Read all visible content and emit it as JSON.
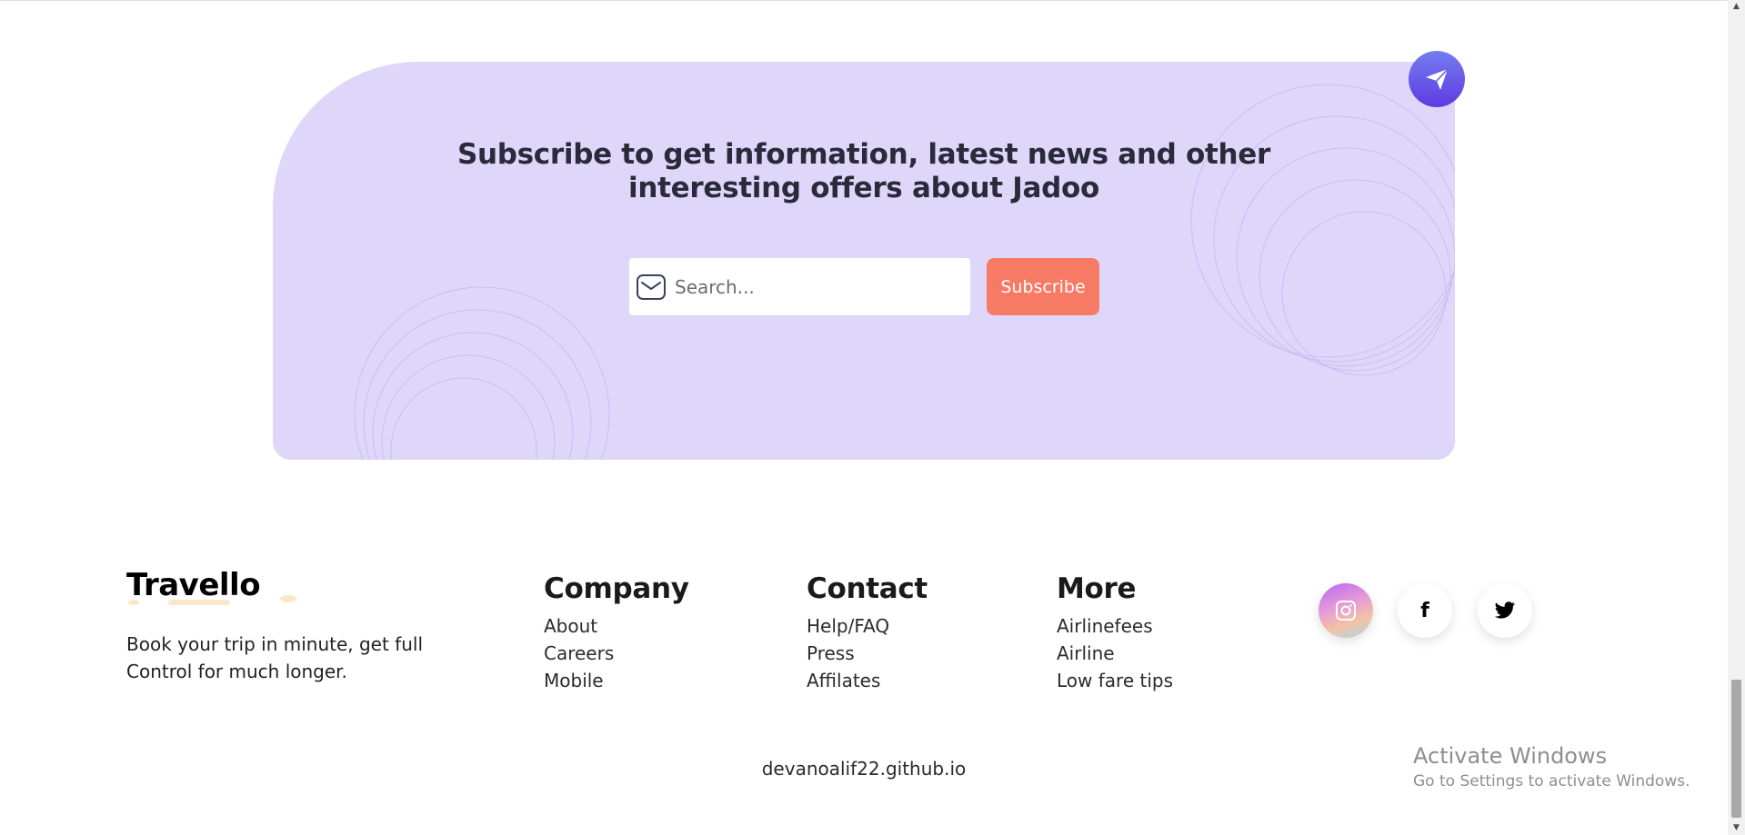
{
  "subscribe": {
    "title_line1": "Subscribe to get information, latest news and other",
    "title_line2": "interesting offers about Jadoo",
    "email_placeholder": "Search...",
    "button_label": "Subscribe",
    "accent_color": "#F67A64",
    "card_color": "#DFD7F9",
    "send_icon": "paper-plane-icon",
    "mail_icon": "mail-icon"
  },
  "footer": {
    "brand": "Travello",
    "description": "Book your trip in minute, get full Control for much longer.",
    "columns": [
      {
        "title": "Company",
        "links": [
          "About",
          "Careers",
          "Mobile"
        ]
      },
      {
        "title": "Contact",
        "links": [
          "Help/FAQ",
          "Press",
          "Affilates"
        ]
      },
      {
        "title": "More",
        "links": [
          "Airlinefees",
          "Airline",
          "Low fare tips"
        ]
      }
    ],
    "social": [
      {
        "name": "instagram",
        "icon": "instagram-icon"
      },
      {
        "name": "facebook",
        "icon": "facebook-icon",
        "glyph": "f"
      },
      {
        "name": "twitter",
        "icon": "twitter-icon"
      }
    ],
    "copyright": "devanoalif22.github.io"
  },
  "watermark": {
    "title": "Activate Windows",
    "subtitle": "Go to Settings to activate Windows."
  }
}
